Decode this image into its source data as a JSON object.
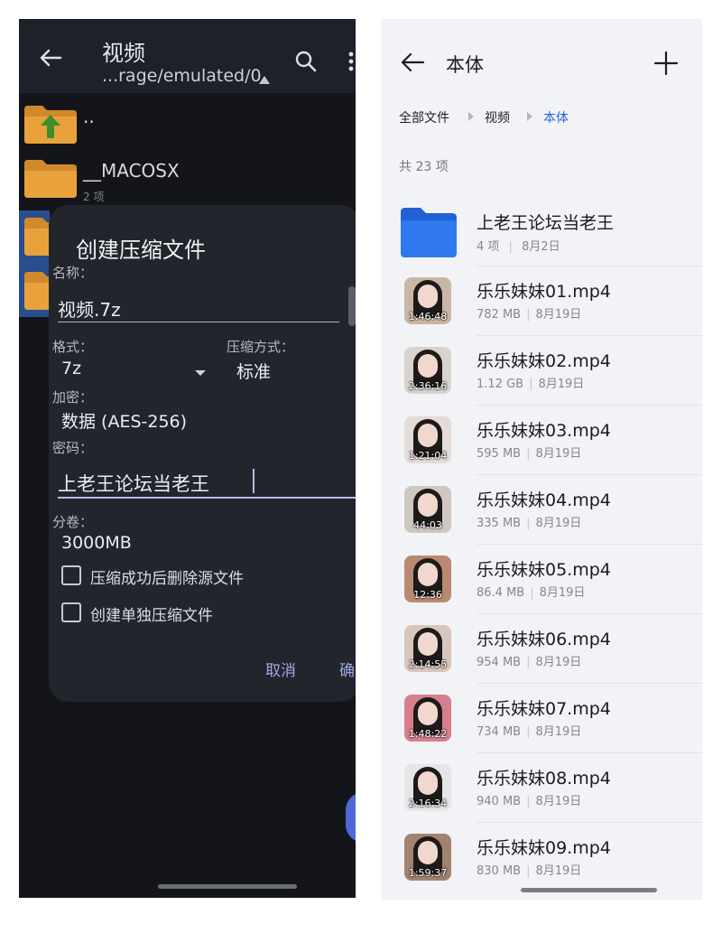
{
  "left_screen": {
    "toolbar": {
      "title": "视频",
      "path": "...rage/emulated/0"
    },
    "files": [
      {
        "label": "..",
        "sub": ""
      },
      {
        "label": "__MACOSX",
        "sub": "2 项"
      }
    ],
    "dialog": {
      "title": "创建压缩文件",
      "name_label": "名称：",
      "name_value": "视频.7z",
      "format_label": "格式：",
      "format_value": "7z",
      "method_label": "压缩方式：",
      "method_value": "标准",
      "encrypt_label": "加密：",
      "encrypt_value": "数据 (AES-256)",
      "password_label": "密码：",
      "password_value": "上老王论坛当老王",
      "split_label": "分卷：",
      "split_value": "3000MB",
      "checkbox_delete": "压缩成功后删除源文件",
      "checkbox_separate": "创建单独压缩文件",
      "cancel": "取消",
      "ok": "确"
    }
  },
  "right_screen": {
    "header": {
      "title": "本体"
    },
    "breadcrumb": [
      "全部文件",
      "视频",
      "本体"
    ],
    "count": "共 23 项",
    "folder": {
      "name": "上老王论坛当老王",
      "items": "4 项",
      "date": "8月2日"
    },
    "files": [
      {
        "name": "乐乐妹妹01.mp4",
        "size": "782 MB",
        "date": "8月19日",
        "duration": "1:46:48",
        "thumb_color": "#c9b6a6"
      },
      {
        "name": "乐乐妹妹02.mp4",
        "size": "1.12 GB",
        "date": "8月19日",
        "duration": "2:36:16",
        "thumb_color": "#d9d3cf"
      },
      {
        "name": "乐乐妹妹03.mp4",
        "size": "595 MB",
        "date": "8月19日",
        "duration": "1:21:04",
        "thumb_color": "#e4dcd8"
      },
      {
        "name": "乐乐妹妹04.mp4",
        "size": "335 MB",
        "date": "8月19日",
        "duration": "44:03",
        "thumb_color": "#cfc7c2"
      },
      {
        "name": "乐乐妹妹05.mp4",
        "size": "86.4 MB",
        "date": "8月19日",
        "duration": "12:36",
        "thumb_color": "#b98a70"
      },
      {
        "name": "乐乐妹妹06.mp4",
        "size": "954 MB",
        "date": "8月19日",
        "duration": "2:14:55",
        "thumb_color": "#d8c6bc"
      },
      {
        "name": "乐乐妹妹07.mp4",
        "size": "734 MB",
        "date": "8月19日",
        "duration": "1:48:22",
        "thumb_color": "#d77f8c"
      },
      {
        "name": "乐乐妹妹08.mp4",
        "size": "940 MB",
        "date": "8月19日",
        "duration": "2:16:34",
        "thumb_color": "#e6e6e8"
      },
      {
        "name": "乐乐妹妹09.mp4",
        "size": "830 MB",
        "date": "8月19日",
        "duration": "1:59:37",
        "thumb_color": "#a1836f"
      }
    ]
  }
}
